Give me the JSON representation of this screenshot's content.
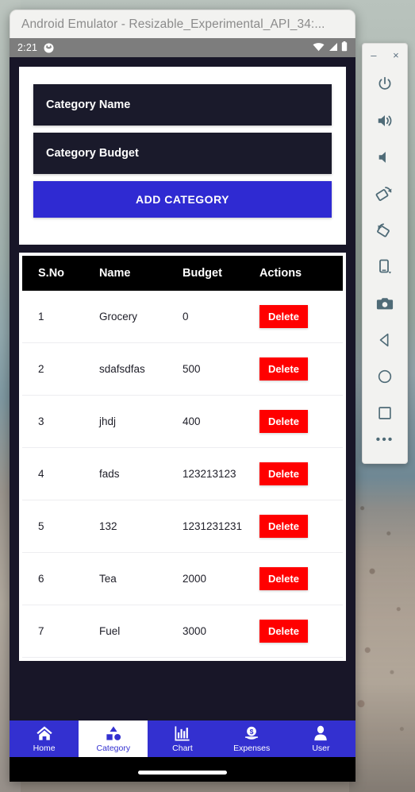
{
  "window": {
    "title": "Android Emulator - Resizable_Experimental_API_34:...",
    "minimize_label": "–",
    "close_label": "×"
  },
  "statusbar": {
    "time": "2:21",
    "notification_icon": "notification-dot-icon",
    "wifi_icon": "wifi-icon",
    "signal_icon": "cellular-signal-icon",
    "battery_icon": "battery-icon"
  },
  "form": {
    "name_placeholder": "Category Name",
    "name_value": "",
    "budget_placeholder": "Category Budget",
    "budget_value": "",
    "add_label": "ADD CATEGORY"
  },
  "table": {
    "headers": [
      "S.No",
      "Name",
      "Budget",
      "Actions"
    ],
    "action_label": "Delete",
    "rows": [
      {
        "sno": "1",
        "name": "Grocery",
        "budget": "0"
      },
      {
        "sno": "2",
        "name": "sdafsdfas",
        "budget": "500"
      },
      {
        "sno": "3",
        "name": "jhdj",
        "budget": "400"
      },
      {
        "sno": "4",
        "name": "fads",
        "budget": "123213123"
      },
      {
        "sno": "5",
        "name": "132",
        "budget": "1231231231"
      },
      {
        "sno": "6",
        "name": "Tea",
        "budget": "2000"
      },
      {
        "sno": "7",
        "name": "Fuel",
        "budget": "3000"
      }
    ]
  },
  "bottomnav": {
    "items": [
      {
        "label": "Home",
        "icon": "home-icon",
        "active": false
      },
      {
        "label": "Category",
        "icon": "shapes-icon",
        "active": true
      },
      {
        "label": "Chart",
        "icon": "bar-chart-icon",
        "active": false
      },
      {
        "label": "Expenses",
        "icon": "money-icon",
        "active": false
      },
      {
        "label": "User",
        "icon": "user-icon",
        "active": false
      }
    ]
  },
  "emulator_toolbar": {
    "buttons": [
      "power-icon",
      "volume-up-icon",
      "volume-down-icon",
      "rotate-left-icon",
      "rotate-right-icon",
      "resize-device-icon",
      "screenshot-camera-icon",
      "back-icon",
      "home-circle-icon",
      "overview-square-icon"
    ],
    "more_label": "•••"
  },
  "colors": {
    "accent_blue": "#2f2ad2",
    "nav_blue": "#3330d0",
    "danger_red": "#ff0000",
    "app_background": "#181628",
    "field_background": "#1a1a2b",
    "table_header": "#000000"
  }
}
